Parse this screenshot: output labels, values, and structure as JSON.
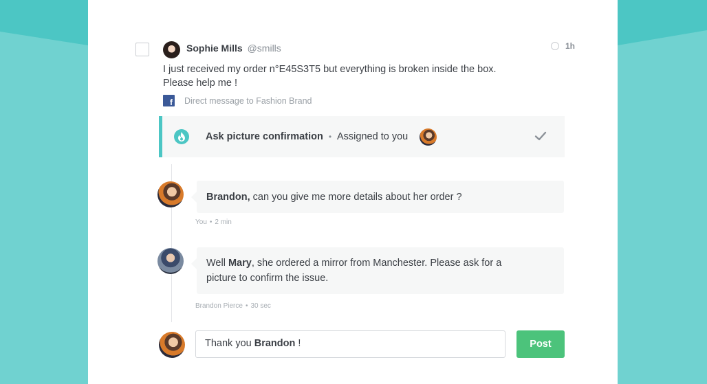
{
  "message": {
    "author_name": "Sophie Mills",
    "author_handle": "@smills",
    "time_ago": "1h",
    "body_line1": "I just received my order n°E45S3T5 but everything is broken inside the box.",
    "body_line2": "Please help me !",
    "source_icon": "f",
    "source_label": "Direct message to Fashion Brand"
  },
  "task": {
    "title": "Ask picture confirmation",
    "separator": "•",
    "assignee_label": "Assigned to you"
  },
  "comments": [
    {
      "mention": "Brandon,",
      "text": " can you give me more details about her order ?",
      "author": "You",
      "time": "2 min"
    },
    {
      "prefix": "Well ",
      "mention": "Mary",
      "text_line1": ", she ordered a mirror from Manchester. Please ask for a",
      "text_line2": "picture to confirm the issue.",
      "author": "Brandon Pierce",
      "time": "30 sec"
    }
  ],
  "meta_separator": "•",
  "reply": {
    "prefix": "Thank you ",
    "mention": "Brandon",
    "suffix": " !",
    "post_label": "Post"
  },
  "colors": {
    "background": "#4cc6c4",
    "accent": "#4cc6c4",
    "post_button": "#4cc37b",
    "facebook": "#3b5998"
  },
  "icons": [
    "checkbox",
    "clock-icon",
    "facebook-icon",
    "flame-icon",
    "checkmark-icon"
  ]
}
